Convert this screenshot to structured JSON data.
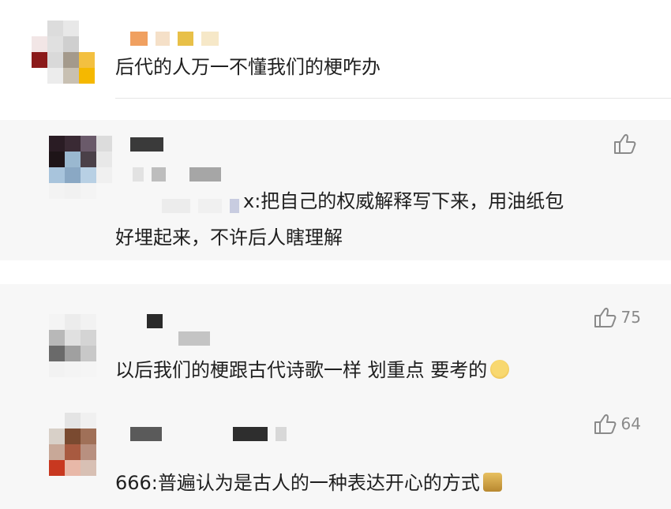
{
  "comments": [
    {
      "text": "后代的人万一不懂我们的梗咋办",
      "likes": ""
    },
    {
      "text_line1": "x:把自己的权威解释写下来，用油纸包",
      "text_line2": "好埋起来，不许后人瞎理解",
      "likes": ""
    },
    {
      "text": "以后我们的梗跟古代诗歌一样 划重点 要考的",
      "likes": "75"
    },
    {
      "text": "666:普遍认为是古人的一种表达开心的方式",
      "likes": "64"
    }
  ],
  "icons": {
    "like": "thumbs-up-icon",
    "emoji_smile": "smiling-face-emoji",
    "emoji_figure": "golden-figure-emoji"
  }
}
